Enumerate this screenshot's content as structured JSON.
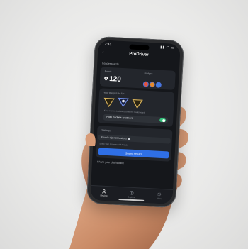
{
  "status_bar": {
    "time": "2:41",
    "icons": "all"
  },
  "app": {
    "title": "ProDriver",
    "back_icon": "chevron-left-icon"
  },
  "section_1": {
    "label": "Leaderboards",
    "points_label": "Points",
    "points_value": "120",
    "badges_label": "Badges",
    "badge_colors": [
      "#e5533b",
      "#e58a2b",
      "#3f7be0"
    ]
  },
  "section_2": {
    "label": "Your badges so far",
    "note": "Keep earning badges to climb the leaderboard",
    "toggle_label": "Hide badges to others",
    "toggle_on": true
  },
  "section_3": {
    "label": "Settings",
    "row_label": "Enable trip notifications",
    "note": "Share your progress with friends",
    "button_label": "Share results"
  },
  "section_4": {
    "label": "Share your dashboard"
  },
  "tabbar": {
    "tabs": [
      {
        "label": "Driving",
        "icon": "person-icon"
      },
      {
        "label": "Explore",
        "icon": "compass-icon"
      },
      {
        "label": "More",
        "icon": "gear-icon"
      }
    ]
  },
  "colors": {
    "accent": "#2f6fe5",
    "toggle": "#33c27a",
    "background": "#15171b"
  }
}
